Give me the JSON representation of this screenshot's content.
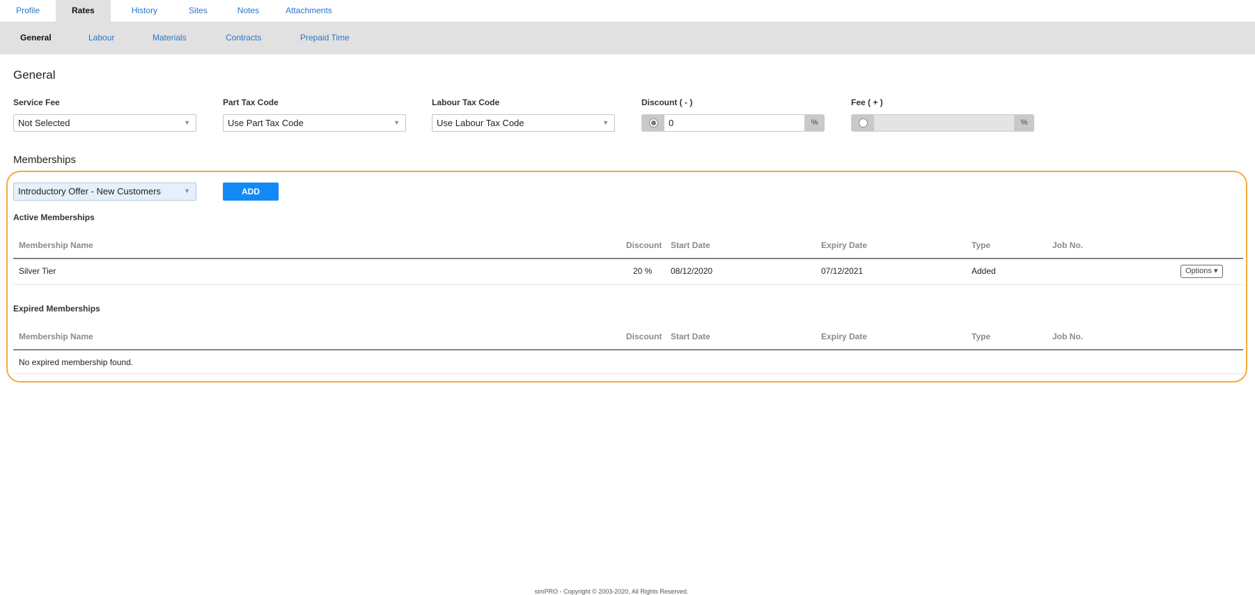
{
  "top_tabs": [
    {
      "label": "Profile",
      "active": false
    },
    {
      "label": "Rates",
      "active": true
    },
    {
      "label": "History",
      "active": false
    },
    {
      "label": "Sites",
      "active": false
    },
    {
      "label": "Notes",
      "active": false
    },
    {
      "label": "Attachments",
      "active": false
    }
  ],
  "sub_tabs": [
    {
      "label": "General",
      "active": true
    },
    {
      "label": "Labour",
      "active": false
    },
    {
      "label": "Materials",
      "active": false
    },
    {
      "label": "Contracts",
      "active": false
    },
    {
      "label": "Prepaid Time",
      "active": false
    }
  ],
  "general": {
    "title": "General",
    "service_fee": {
      "label": "Service Fee",
      "value": "Not Selected"
    },
    "part_tax_code": {
      "label": "Part Tax Code",
      "value": "Use Part Tax Code"
    },
    "labour_tax_code": {
      "label": "Labour Tax Code",
      "value": "Use Labour Tax Code"
    },
    "discount": {
      "label": "Discount ( - )",
      "value": "0",
      "unit": "%",
      "selected": true
    },
    "fee": {
      "label": "Fee ( + )",
      "value": "",
      "unit": "%",
      "selected": false
    }
  },
  "memberships": {
    "title": "Memberships",
    "select_value": "Introductory Offer - New Customers",
    "add_label": "ADD",
    "highlight_color": "#f4a938",
    "columns": [
      "Membership Name",
      "Discount",
      "Start Date",
      "Expiry Date",
      "Type",
      "Job No."
    ],
    "active": {
      "title": "Active Memberships",
      "rows": [
        {
          "name": "Silver Tier",
          "discount": "20 %",
          "start_date": "08/12/2020",
          "expiry_date": "07/12/2021",
          "type": "Added",
          "job_no": "",
          "options_label": "Options ▾"
        }
      ]
    },
    "expired": {
      "title": "Expired Memberships",
      "empty_message": "No expired membership found."
    }
  },
  "footer": "simPRO - Copyright © 2003-2020, All Rights Reserved."
}
